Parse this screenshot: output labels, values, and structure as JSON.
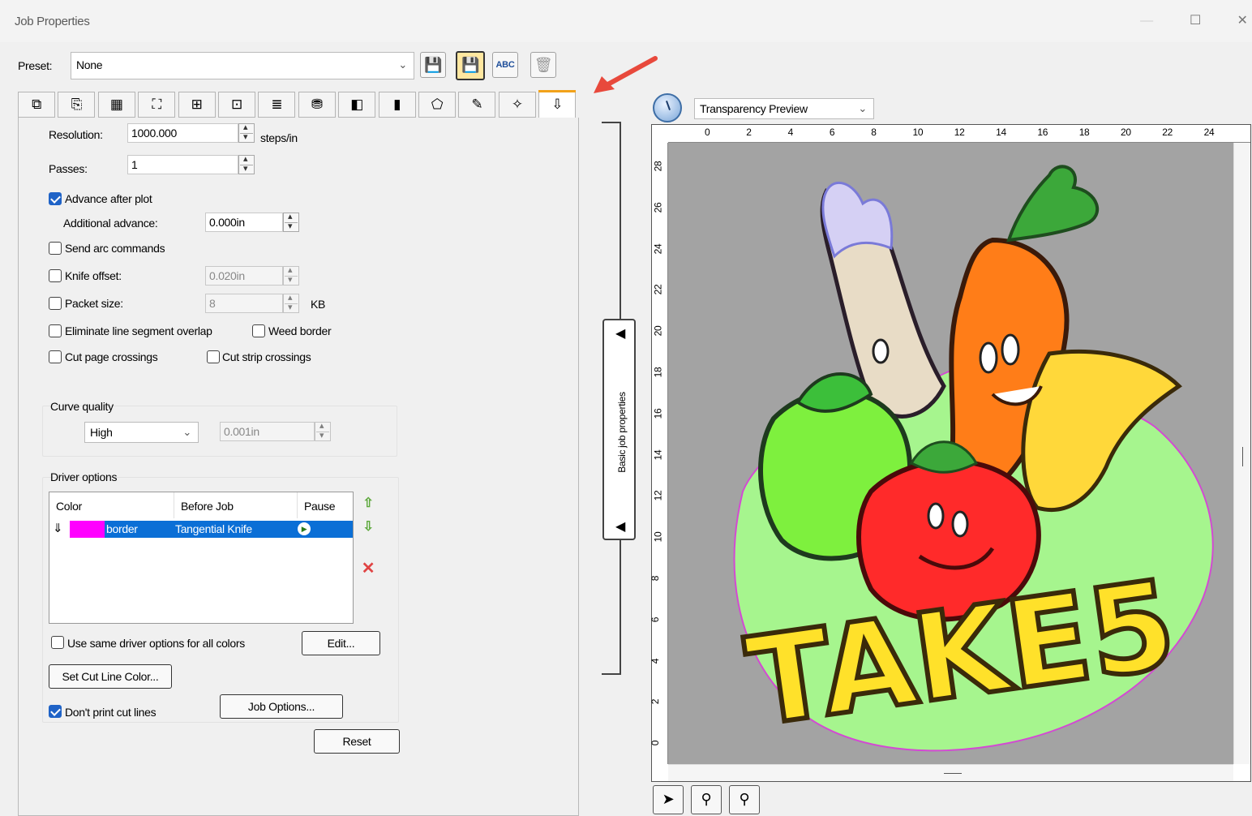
{
  "window": {
    "title": "Job Properties",
    "min": "—",
    "max": "☐",
    "close": "✕"
  },
  "preset": {
    "label": "Preset:",
    "value": "None",
    "buttons": {
      "save": "💾",
      "save_as": "💾",
      "rename": "ABC",
      "delete": "🗑"
    }
  },
  "tabs": [
    "⧉",
    "⎘",
    "▦",
    "⛶",
    "⊞",
    "⊡",
    "≣",
    "⛃",
    "◧",
    "▮",
    "⬠",
    "✎",
    "✧",
    "⇩"
  ],
  "fields": {
    "resolution": {
      "label": "Resolution:",
      "value": "1000.000",
      "unit": "steps/in"
    },
    "passes": {
      "label": "Passes:",
      "value": "1"
    },
    "advance_after_plot": {
      "label": "Advance after plot",
      "checked": true
    },
    "additional_advance": {
      "label": "Additional advance:",
      "value": "0.000in"
    },
    "send_arc": {
      "label": "Send arc commands",
      "checked": false
    },
    "knife_offset": {
      "label": "Knife offset:",
      "value": "0.020in",
      "checked": false
    },
    "packet_size": {
      "label": "Packet size:",
      "value": "8",
      "unit": "KB",
      "checked": false
    },
    "eliminate_overlap": {
      "label": "Eliminate line segment overlap",
      "checked": false
    },
    "weed_border": {
      "label": "Weed border",
      "checked": false
    },
    "cut_page_crossings": {
      "label": "Cut page crossings",
      "checked": false
    },
    "cut_strip_crossings": {
      "label": "Cut strip crossings",
      "checked": false
    }
  },
  "curve_quality": {
    "label": "Curve quality",
    "select": "High",
    "tolerance": "0.001in"
  },
  "driver_options": {
    "label": "Driver options",
    "columns": [
      "Color",
      "Before Job",
      "Pause"
    ],
    "rows": [
      {
        "color_name": "border",
        "swatch": "#ff00ff",
        "before_job": "Tangential Knife",
        "pause": "▶"
      }
    ],
    "use_same_label": "Use same driver options for all colors",
    "edit_button": "Edit...",
    "set_cut_line_button": "Set Cut Line Color...",
    "dont_print_label": "Don't print cut lines",
    "dont_print_checked": true,
    "job_options_button": "Job Options...",
    "reset_button": "Reset"
  },
  "splitter": {
    "label": "Basic job properties",
    "arrow_up": "◀",
    "arrow_down": "◀"
  },
  "preview": {
    "mode": "Transparency Preview",
    "ruler_top": [
      "0",
      "2",
      "4",
      "6",
      "8",
      "10",
      "12",
      "14",
      "16",
      "18",
      "20",
      "22",
      "24"
    ],
    "ruler_left": [
      "28",
      "26",
      "24",
      "22",
      "20",
      "18",
      "16",
      "14",
      "12",
      "10",
      "8",
      "6",
      "4",
      "2",
      "0"
    ],
    "artwork_text": "TAKE5"
  },
  "colors": {
    "accent": "#f2a21a",
    "selection": "#0b6fd6",
    "canvas": "#a3a3a3"
  }
}
